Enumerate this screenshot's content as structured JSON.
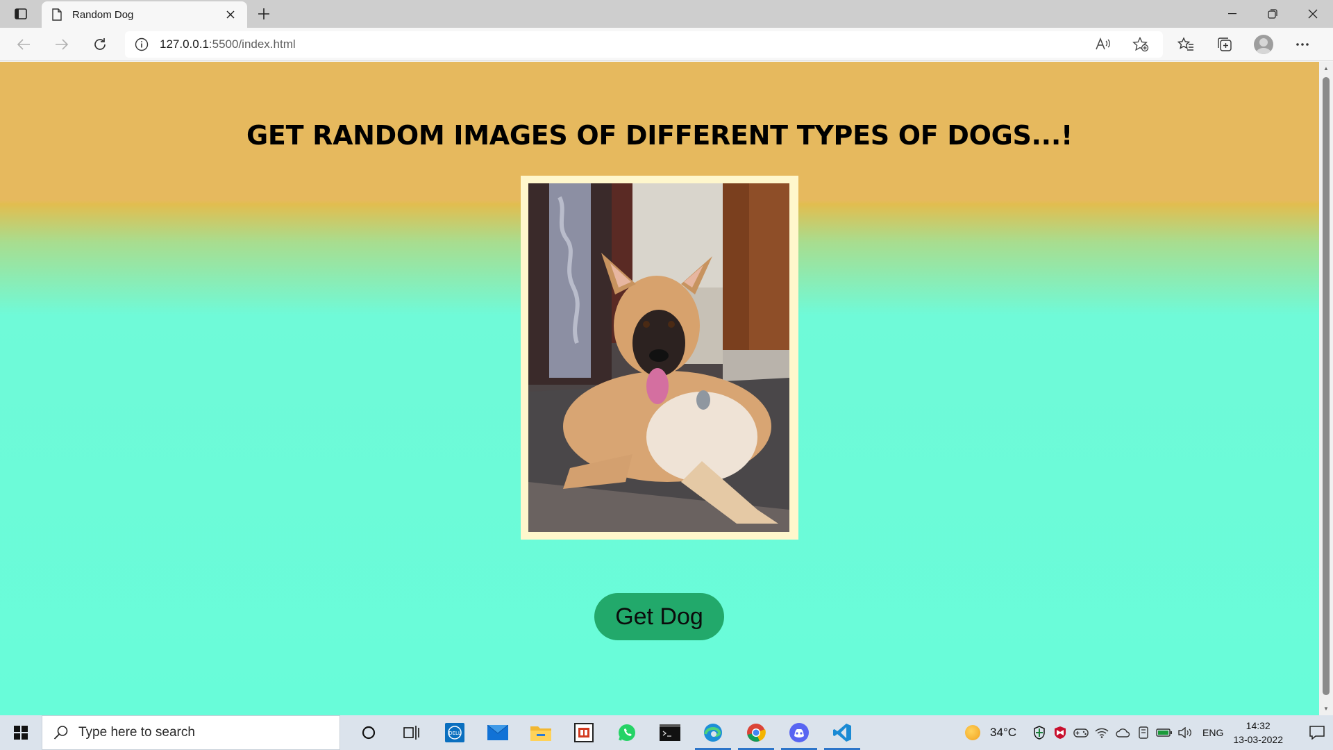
{
  "browser": {
    "tab_title": "Random Dog",
    "url_host": "127.0.0.1",
    "url_path": ":5500/index.html",
    "icons": [
      "tab-actions-icon",
      "page-icon",
      "close-icon",
      "plus-icon",
      "minimize-icon",
      "restore-icon",
      "close-window-icon",
      "back-arrow-icon",
      "forward-arrow-icon",
      "refresh-icon",
      "info-icon",
      "read-aloud-icon",
      "add-favorite-icon",
      "favorites-icon",
      "collections-icon",
      "profile-avatar-icon",
      "more-icon"
    ]
  },
  "page": {
    "heading": "GET RANDOM IMAGES OF DIFFERENT TYPES OF DOGS...!",
    "button_label": "Get Dog",
    "colors": {
      "top_band": "#e6b95e",
      "bottom_band": "#68fcd9",
      "button": "#22a96b",
      "frame": "#fff7cc"
    }
  },
  "taskbar": {
    "search_placeholder": "Type here to search",
    "temperature": "34°C",
    "language": "ENG",
    "time": "14:32",
    "date": "13-03-2022",
    "apps": [
      "cortana-icon",
      "task-view-icon",
      "dell-icon",
      "mail-icon",
      "file-explorer-icon",
      "office-icon",
      "whatsapp-icon",
      "terminal-icon",
      "edge-icon",
      "chrome-icon",
      "discord-icon",
      "vscode-icon"
    ]
  }
}
